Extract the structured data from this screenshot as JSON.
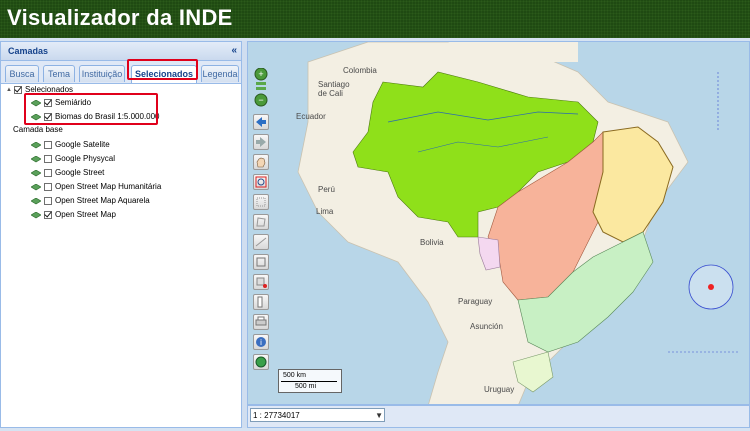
{
  "app": {
    "title": "Visualizador da INDE"
  },
  "panel": {
    "title": "Camadas",
    "collapse_icon": "«",
    "tabs": [
      {
        "label": "Busca",
        "active": false
      },
      {
        "label": "Tema",
        "active": false
      },
      {
        "label": "Instituição",
        "active": false
      },
      {
        "label": "Selecionados",
        "active": true
      },
      {
        "label": "Legenda",
        "active": false
      }
    ]
  },
  "tree": {
    "selecionados": {
      "label": "Selecionados",
      "checked": true
    },
    "selected_layers": [
      {
        "label": "Semiárido",
        "checked": true
      },
      {
        "label": "Biomas do Brasil 1:5.000.000",
        "checked": true
      }
    ],
    "base": {
      "label": "Camada base"
    },
    "base_layers": [
      {
        "label": "Google Satelite",
        "checked": false
      },
      {
        "label": "Google Physycal",
        "checked": false
      },
      {
        "label": "Google Street",
        "checked": false
      },
      {
        "label": "Open Street Map Humanitária",
        "checked": false
      },
      {
        "label": "Open Street Map Aquarela",
        "checked": false
      },
      {
        "label": "Open Street Map",
        "checked": true
      }
    ]
  },
  "map": {
    "labels": {
      "colombia": "Colombia",
      "cali": "Santiago\nde Cali",
      "ecuador": "Ecuador",
      "peru": "Perú",
      "lima": "Lima",
      "bolivia": "Bolivia",
      "paraguay": "Paraguay",
      "asuncion": "Asunción",
      "uruguay": "Uruguay"
    },
    "scale_km": "500 km",
    "scale_mi": "500 mi",
    "colors": {
      "amazonia": "#8fe01a",
      "cerrado": "#f7b39a",
      "caatinga": "#fbe8a0",
      "mata_atlantica": "#c8f0c4",
      "pantanal": "#f4d8f0",
      "pampa": "#e8f7d0",
      "ocean": "#b8d6e8",
      "land": "#f3efe3"
    }
  },
  "status": {
    "scale_value": "1 : 27734017",
    "dropdown_icon": "chevron-down-icon"
  },
  "icons": [
    "zoom-in-icon",
    "zoom-slider-icon",
    "zoom-out-icon",
    "back-icon",
    "forward-icon",
    "pan-icon",
    "zoom-box-icon",
    "select-icon",
    "draw-polygon-icon",
    "measure-area-icon",
    "measure-line-icon",
    "clear-icon",
    "print-icon",
    "info-icon",
    "globe-icon"
  ]
}
